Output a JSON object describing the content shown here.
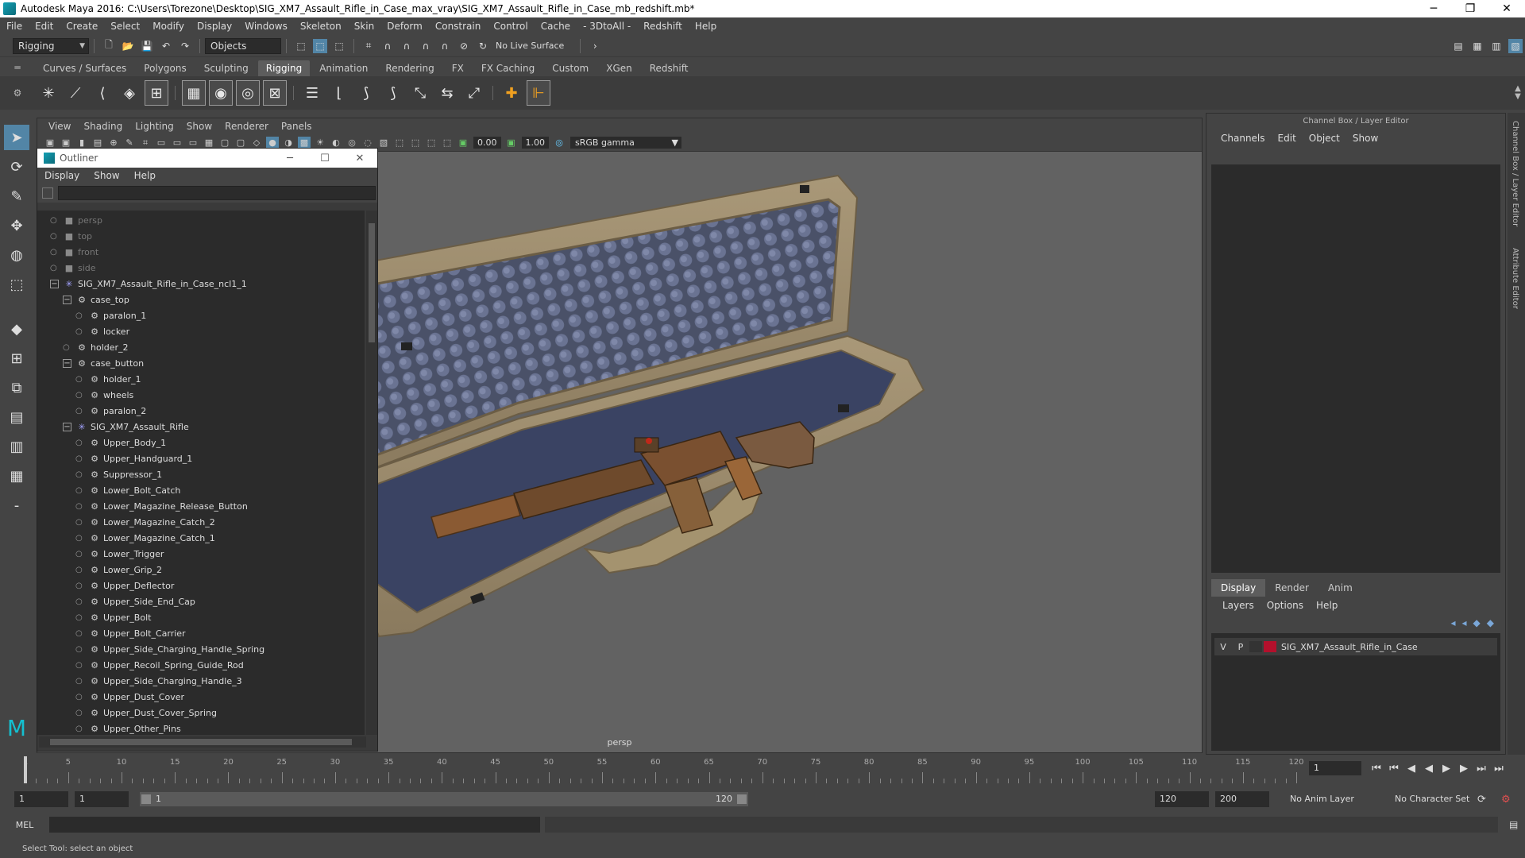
{
  "window": {
    "title": "Autodesk Maya 2016: C:\\Users\\Torezone\\Desktop\\SIG_XM7_Assault_Rifle_in_Case_max_vray\\SIG_XM7_Assault_Rifle_in_Case_mb_redshift.mb*",
    "minimize": "─",
    "maximize": "❐",
    "close": "✕"
  },
  "menubar": [
    "File",
    "Edit",
    "Create",
    "Select",
    "Modify",
    "Display",
    "Windows",
    "Skeleton",
    "Skin",
    "Deform",
    "Constrain",
    "Control",
    "Cache",
    "- 3DtoAll -",
    "Redshift",
    "Help"
  ],
  "statusline": {
    "mode": "Rigging",
    "selection_mode": "Objects",
    "live_surface": "No Live Surface"
  },
  "shelf_tabs": [
    "Curves / Surfaces",
    "Polygons",
    "Sculpting",
    "Rigging",
    "Animation",
    "Rendering",
    "FX",
    "FX Caching",
    "Custom",
    "XGen",
    "Redshift"
  ],
  "shelf_active": "Rigging",
  "viewport": {
    "menu": [
      "View",
      "Shading",
      "Lighting",
      "Show",
      "Renderer",
      "Panels"
    ],
    "exposure": "0.00",
    "gamma": "1.00",
    "color_space": "sRGB gamma",
    "camera": "persp"
  },
  "outliner": {
    "title": "Outliner",
    "menu": [
      "Display",
      "Show",
      "Help"
    ],
    "rows": [
      {
        "label": "persp",
        "indent": 0,
        "icon": "camera",
        "dim": true
      },
      {
        "label": "top",
        "indent": 0,
        "icon": "camera",
        "dim": true
      },
      {
        "label": "front",
        "indent": 0,
        "icon": "camera",
        "dim": true
      },
      {
        "label": "side",
        "indent": 0,
        "icon": "camera",
        "dim": true
      },
      {
        "label": "SIG_XM7_Assault_Rifle_in_Case_ncl1_1",
        "indent": 0,
        "icon": "star",
        "expand": "−"
      },
      {
        "label": "case_top",
        "indent": 1,
        "icon": "mesh",
        "expand": "−"
      },
      {
        "label": "paralon_1",
        "indent": 2,
        "icon": "mesh"
      },
      {
        "label": "locker",
        "indent": 2,
        "icon": "mesh"
      },
      {
        "label": "holder_2",
        "indent": 1,
        "icon": "mesh"
      },
      {
        "label": "case_button",
        "indent": 1,
        "icon": "mesh",
        "expand": "−"
      },
      {
        "label": "holder_1",
        "indent": 2,
        "icon": "mesh"
      },
      {
        "label": "wheels",
        "indent": 2,
        "icon": "mesh"
      },
      {
        "label": "paralon_2",
        "indent": 2,
        "icon": "mesh"
      },
      {
        "label": "SIG_XM7_Assault_Rifle",
        "indent": 1,
        "icon": "star",
        "expand": "−"
      },
      {
        "label": "Upper_Body_1",
        "indent": 2,
        "icon": "mesh"
      },
      {
        "label": "Upper_Handguard_1",
        "indent": 2,
        "icon": "mesh"
      },
      {
        "label": "Suppressor_1",
        "indent": 2,
        "icon": "mesh"
      },
      {
        "label": "Lower_Bolt_Catch",
        "indent": 2,
        "icon": "mesh"
      },
      {
        "label": "Lower_Magazine_Release_Button",
        "indent": 2,
        "icon": "mesh"
      },
      {
        "label": "Lower_Magazine_Catch_2",
        "indent": 2,
        "icon": "mesh"
      },
      {
        "label": "Lower_Magazine_Catch_1",
        "indent": 2,
        "icon": "mesh"
      },
      {
        "label": "Lower_Trigger",
        "indent": 2,
        "icon": "mesh"
      },
      {
        "label": "Lower_Grip_2",
        "indent": 2,
        "icon": "mesh"
      },
      {
        "label": "Upper_Deflector",
        "indent": 2,
        "icon": "mesh"
      },
      {
        "label": "Upper_Side_End_Cap",
        "indent": 2,
        "icon": "mesh"
      },
      {
        "label": "Upper_Bolt",
        "indent": 2,
        "icon": "mesh"
      },
      {
        "label": "Upper_Bolt_Carrier",
        "indent": 2,
        "icon": "mesh"
      },
      {
        "label": "Upper_Side_Charging_Handle_Spring",
        "indent": 2,
        "icon": "mesh"
      },
      {
        "label": "Upper_Recoil_Spring_Guide_Rod",
        "indent": 2,
        "icon": "mesh"
      },
      {
        "label": "Upper_Side_Charging_Handle_3",
        "indent": 2,
        "icon": "mesh"
      },
      {
        "label": "Upper_Dust_Cover",
        "indent": 2,
        "icon": "mesh"
      },
      {
        "label": "Upper_Dust_Cover_Spring",
        "indent": 2,
        "icon": "mesh"
      },
      {
        "label": "Upper_Other_Pins",
        "indent": 2,
        "icon": "mesh"
      }
    ]
  },
  "channel_box": {
    "title": "Channel Box / Layer Editor",
    "menu": [
      "Channels",
      "Edit",
      "Object",
      "Show"
    ],
    "side_tabs": [
      "Channel Box / Layer Editor",
      "Attribute Editor"
    ]
  },
  "layer_editor": {
    "tabs": [
      "Display",
      "Render",
      "Anim"
    ],
    "active_tab": "Display",
    "menu": [
      "Layers",
      "Options",
      "Help"
    ],
    "layers": [
      {
        "v": "V",
        "p": "P",
        "name": "SIG_XM7_Assault_Rifle_in_Case",
        "color": "#b3102c"
      }
    ]
  },
  "timeslider": {
    "ticks": [
      "1",
      "5",
      "10",
      "15",
      "20",
      "25",
      "30",
      "35",
      "40",
      "45",
      "50",
      "55",
      "60",
      "65",
      "70",
      "75",
      "80",
      "85",
      "90",
      "95",
      "100",
      "105",
      "110",
      "115",
      "120"
    ],
    "current_frame": "1"
  },
  "range": {
    "start": "1",
    "playback_start": "1",
    "bar_start": "1",
    "bar_end": "120",
    "playback_end": "120",
    "end": "200",
    "anim_layer": "No Anim Layer",
    "character_set": "No Character Set"
  },
  "cmdline": {
    "label": "MEL"
  },
  "helpline": "Select Tool: select an object"
}
